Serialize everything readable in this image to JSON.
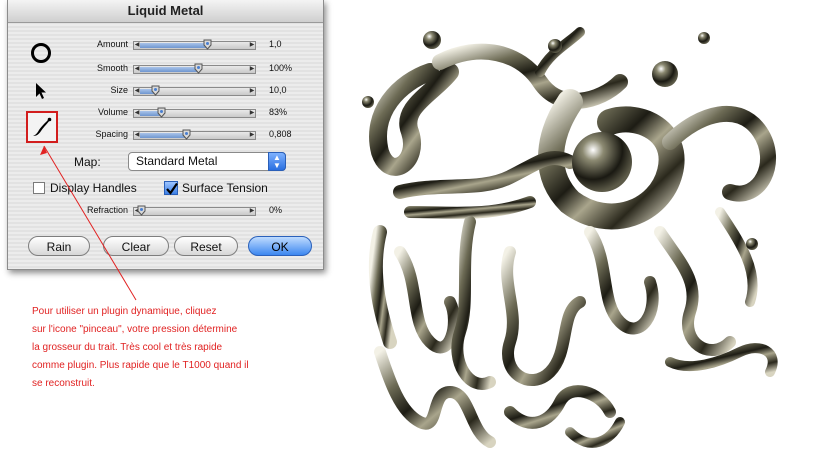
{
  "dialog": {
    "title": "Liquid Metal",
    "tools": [
      {
        "name": "circle-tool",
        "selected": false
      },
      {
        "name": "arrow-tool",
        "selected": false
      },
      {
        "name": "brush-tool",
        "selected": true
      }
    ],
    "sliders": [
      {
        "label": "Amount",
        "value": "1,0",
        "fraction": 0.62
      },
      {
        "label": "Smooth",
        "value": "100%",
        "fraction": 0.53
      },
      {
        "label": "Size",
        "value": "10,0",
        "fraction": 0.13
      },
      {
        "label": "Volume",
        "value": "83%",
        "fraction": 0.19
      },
      {
        "label": "Spacing",
        "value": "0,808",
        "fraction": 0.42
      }
    ],
    "map": {
      "label": "Map:",
      "selected": "Standard Metal"
    },
    "checkboxes": [
      {
        "label": "Display Handles",
        "checked": false
      },
      {
        "label": "Surface Tension",
        "checked": true
      }
    ],
    "refraction": {
      "label": "Refraction",
      "value": "0%",
      "fraction": 0.0
    },
    "buttons": {
      "rain": "Rain",
      "clear": "Clear",
      "reset": "Reset",
      "ok": "OK"
    }
  },
  "annotation": {
    "lines": [
      "Pour utiliser un plugin dynamique, cliquez",
      "sur l'icone \"pinceau\", votre pression détermine",
      "la grosseur du trait. Très cool et très rapide",
      "comme plugin. Plus rapide que le T1000 quand il",
      "se reconstruit."
    ]
  },
  "colors": {
    "annotation": "#e12222",
    "accent": "#3c87f0"
  }
}
